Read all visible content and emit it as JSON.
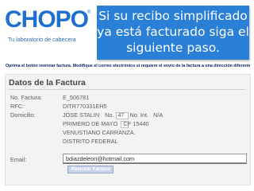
{
  "header": {
    "brand": {
      "wordmark": "CHOPO",
      "registered_mark": "®",
      "tagline": "Tu laboratorio de cabecera",
      "color": "#1f6fd1"
    },
    "callout": {
      "lines": [
        "Si su recibo simplificado",
        "ya está facturado siga el",
        "siguiente paso."
      ],
      "background": "#2a7fd6"
    }
  },
  "instruction": "Oprima el botón reenviar factura. Modifique el correo electrónico si requiere el envío de la factura a una dirección diferente.",
  "form": {
    "title": "Datos de la Factura",
    "fields": {
      "folio": {
        "label": "No. Factura:",
        "value": "E_506781"
      },
      "rfc": {
        "label": "RFC:",
        "value": "DITR770331EH5"
      },
      "domicilio": {
        "label": "Domicilio:",
        "street": "JOSE STALIN",
        "no_label": "No.",
        "no_ext": "47",
        "int_label": "No. Int.",
        "no_int": "N/A",
        "colonia": "PRIMERO DE MAYO",
        "cp_label": "CP",
        "cp": "15440",
        "municipio": "VENUSTIANO CARRANZA.",
        "estado": "DISTRITO FEDERAL"
      },
      "email": {
        "label": "Email:",
        "value": "bdiazdeleon@hotmail.com"
      }
    },
    "button_label": "Reenviar Factura"
  }
}
